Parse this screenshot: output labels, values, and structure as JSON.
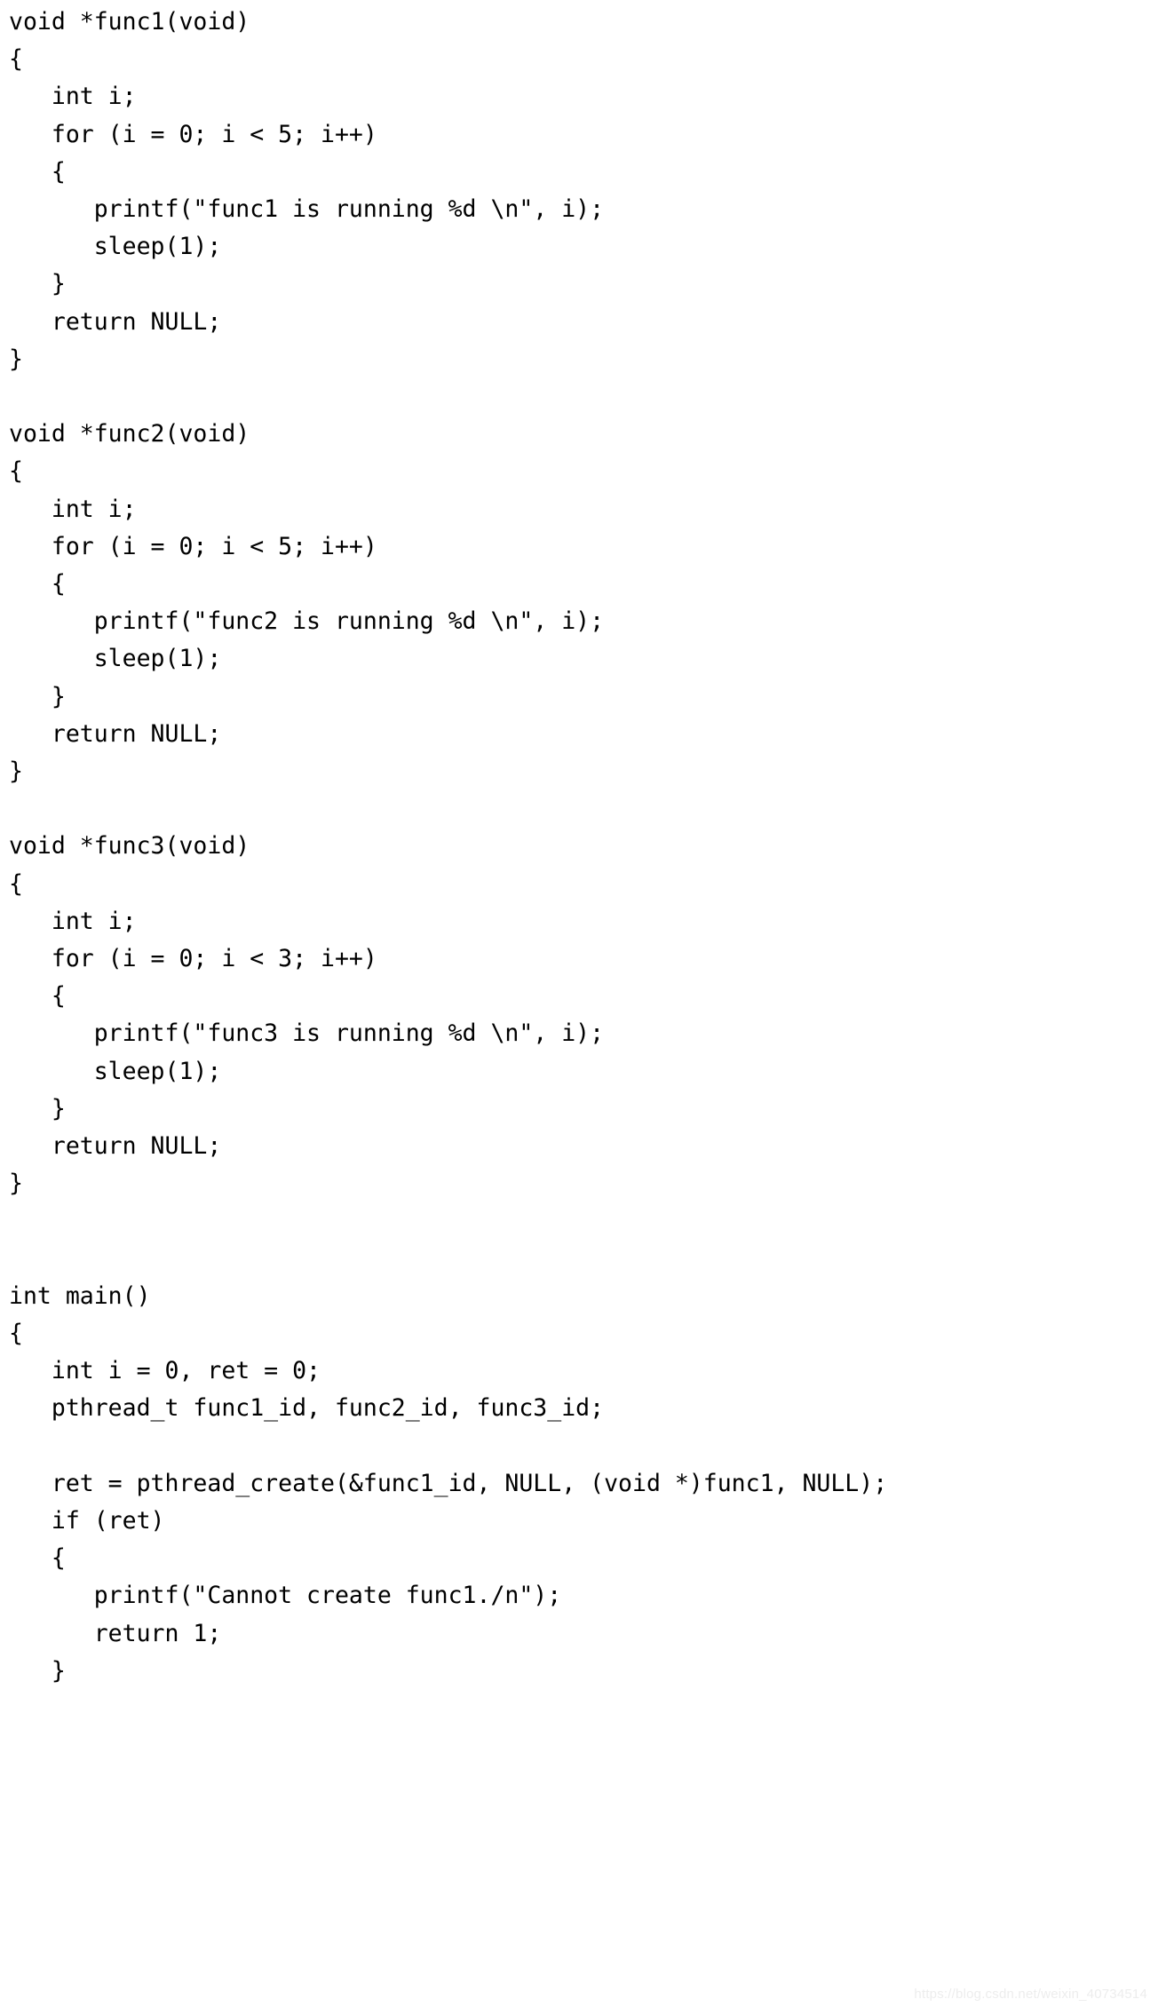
{
  "document": {
    "type": "source-code-listing",
    "language": "C",
    "background_color": "#ffffff",
    "text_color": "#000000"
  },
  "watermark": {
    "text": "https://blog.csdn.net/weixin_40734514",
    "color": "#ededed"
  },
  "code": {
    "lines": [
      "void *func1(void)",
      "{",
      "   int i;",
      "   for (i = 0; i < 5; i++)",
      "   {",
      "      printf(\"func1 is running %d \\n\", i);",
      "      sleep(1);",
      "   }",
      "   return NULL;",
      "}",
      "",
      "void *func2(void)",
      "{",
      "   int i;",
      "   for (i = 0; i < 5; i++)",
      "   {",
      "      printf(\"func2 is running %d \\n\", i);",
      "      sleep(1);",
      "   }",
      "   return NULL;",
      "}",
      "",
      "void *func3(void)",
      "{",
      "   int i;",
      "   for (i = 0; i < 3; i++)",
      "   {",
      "      printf(\"func3 is running %d \\n\", i);",
      "      sleep(1);",
      "   }",
      "   return NULL;",
      "}",
      "",
      "",
      "int main()",
      "{",
      "   int i = 0, ret = 0;",
      "   pthread_t func1_id, func2_id, func3_id;",
      "",
      "   ret = pthread_create(&func1_id, NULL, (void *)func1, NULL);",
      "   if (ret)",
      "   {",
      "      printf(\"Cannot create func1./n\");",
      "      return 1;",
      "   }"
    ]
  }
}
